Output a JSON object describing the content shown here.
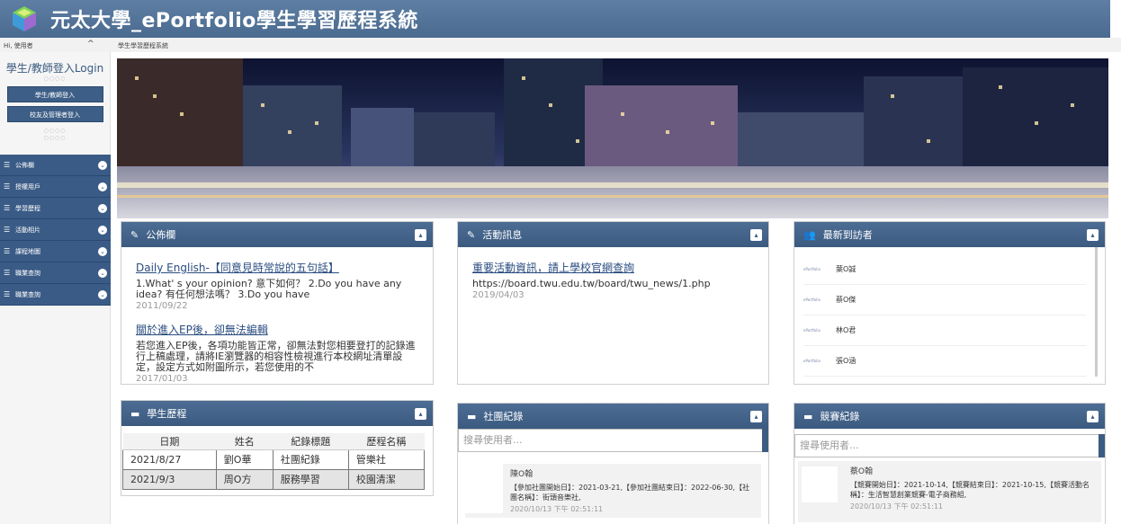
{
  "header": {
    "title": "元太大學_ePortfolio學生學習歷程系統",
    "greeting": "Hi, 使用者",
    "collapse_icon": "chevron-up-icon",
    "breadcrumb": "學生學習歷程系統"
  },
  "sidebar": {
    "login_title": "學生/教師登入Login",
    "dots": "○○○○",
    "buttons": [
      "學生/教師登入",
      "校友及管理者登入"
    ],
    "menu": [
      {
        "label": "公佈欄"
      },
      {
        "label": "授權用戶"
      },
      {
        "label": "學習歷程"
      },
      {
        "label": "活動相片"
      },
      {
        "label": "課程地圖"
      },
      {
        "label": "職業查詢"
      },
      {
        "label": "職業查詢"
      }
    ]
  },
  "bulletin": {
    "title": "公佈欄",
    "items": [
      {
        "title": "Daily English-【同意見時常說的五句話】",
        "body": "1.What' s your opinion? 意下如何？ 2.Do you have any idea? 有任何想法嗎？ 3.Do you have",
        "date": "2011/09/22"
      },
      {
        "title": "關於進入EP後，卻無法編輯",
        "body": "若您進入EP後，各項功能皆正常，卻無法對您相要登打的記錄進行上稿處理，請將IE瀏覽器的相容性檢視進行本校網址清單設定，設定方式如附圖所示，若您使用的不",
        "date": "2017/01/03"
      }
    ]
  },
  "activity": {
    "title": "活動訊息",
    "items": [
      {
        "title": "重要活動資訊，請上學校官網查詢",
        "body": "https://board.twu.edu.tw/board/twu_news/1.php",
        "date": "2019/04/03"
      }
    ]
  },
  "visitors": {
    "title": "最新到訪者",
    "logo_text": "ePortfolio",
    "items": [
      "葉O誠",
      "蔡O傑",
      "林O君",
      "張O涵"
    ]
  },
  "history": {
    "title": "學生歷程",
    "columns": [
      "日期",
      "姓名",
      "紀錄標題",
      "歷程名稱"
    ],
    "rows": [
      [
        "2021/8/27",
        "劉O華",
        "社團紀錄",
        "管樂社"
      ],
      [
        "2021/9/3",
        "周O方",
        "服務學習",
        "校園清潔"
      ]
    ]
  },
  "club": {
    "title": "社團紀錄",
    "search_placeholder": "搜尋使用者...",
    "record": {
      "name": "陳O翰",
      "body": "【參加社團開始日】：2021-03-21,【參加社團結束日】：2022-06-30,【社團名稱】：街頭音樂社,",
      "date": "2020/10/13 下午 02:51:11"
    }
  },
  "competition": {
    "title": "競賽紀錄",
    "search_placeholder": "搜尋使用者...",
    "record": {
      "name": "蔡O翰",
      "body": "【競賽開始日】：2021-10-14,【競賽結束日】：2021-10-15,【競賽活動名稱】：生活智慧創業競賽-電子商務組,",
      "date": "2020/10/13 下午 02:51:11"
    }
  },
  "colors": {
    "accent": "#3b5a80",
    "header": "#4a6a8f",
    "link": "#2a4d80"
  }
}
